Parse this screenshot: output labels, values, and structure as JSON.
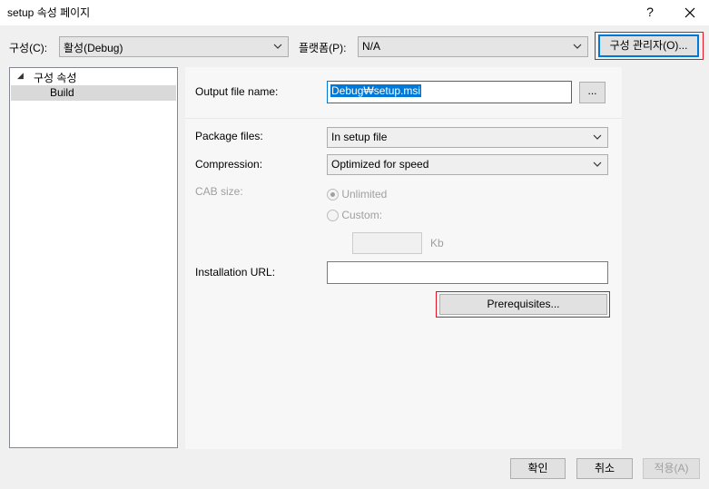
{
  "window": {
    "title": "setup 속성 페이지",
    "help_label": "?",
    "close_label": "✕"
  },
  "toolbar": {
    "config_label": "구성(C):",
    "config_value": "활성(Debug)",
    "platform_label": "플랫폼(P):",
    "platform_value": "N/A",
    "config_manager_label": "구성 관리자(O)..."
  },
  "tree": {
    "root_arrow": "◢",
    "root_label": "구성 속성",
    "child_label": "Build"
  },
  "form": {
    "output_label": "Output file name:",
    "output_value": "Debug₩setup.msi",
    "browse_label": "...",
    "package_label": "Package files:",
    "package_value": "In setup file",
    "compression_label": "Compression:",
    "compression_value": "Optimized for speed",
    "cab_label": "CAB size:",
    "unlimited_label": "Unlimited",
    "custom_label": "Custom:",
    "kb_label": "Kb",
    "install_url_label": "Installation URL:",
    "install_url_value": "",
    "prerequisites_label": "Prerequisites..."
  },
  "footer": {
    "ok_label": "확인",
    "cancel_label": "취소",
    "apply_label": "적용(A)"
  }
}
